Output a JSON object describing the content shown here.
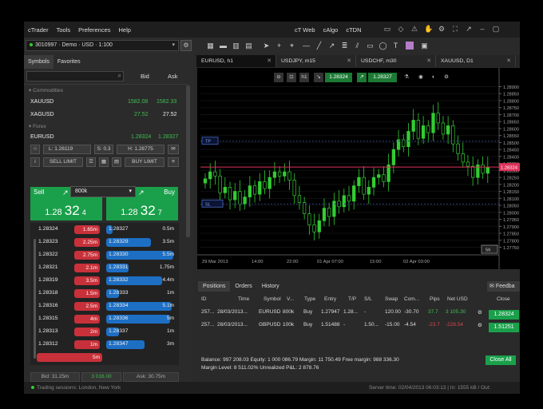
{
  "menu": {
    "items": [
      "cTrader",
      "Tools",
      "Preferences",
      "Help"
    ],
    "right_items": [
      "cT Web",
      "cAlgo",
      "cTDN"
    ]
  },
  "account": {
    "label": "3010997 · Demo · USD · 1:100"
  },
  "watchlist": {
    "tabs": [
      "Symbols",
      "Favorites"
    ],
    "bid_header": "Bid",
    "ask_header": "Ask",
    "groups": [
      {
        "name": "Commodities",
        "symbols": [
          {
            "name": "XAUUSD",
            "bid": "1582.08",
            "ask": "1582.33"
          },
          {
            "name": "XAGUSD",
            "bid": "27.52",
            "ask": "27.52"
          }
        ]
      },
      {
        "name": "Forex",
        "symbols": [
          {
            "name": "EURUSD",
            "bid": "1.28324",
            "ask": "1.28327"
          }
        ]
      }
    ],
    "expanded": {
      "low": "L: 1.28119",
      "spread": "S: 0.3",
      "high": "H: 1.28775",
      "sell_limit": "SELL LIMIT",
      "buy_limit": "BUY LIMIT"
    }
  },
  "trade": {
    "sell_label": "Sell",
    "buy_label": "Buy",
    "quantity": "800k",
    "sell_price": {
      "prefix": "1.28",
      "big": "32",
      "suffix": "4"
    },
    "buy_price": {
      "prefix": "1.28",
      "big": "32",
      "suffix": "7"
    }
  },
  "ladder": [
    {
      "bid": "1.28324",
      "bid_vol": "1.65m",
      "ask": "1.28327",
      "ask_vol": "0.5m"
    },
    {
      "bid": "1.28323",
      "bid_vol": "2.25m",
      "ask": "1.28329",
      "ask_vol": "3.5m"
    },
    {
      "bid": "1.28322",
      "bid_vol": "2.75m",
      "ask": "1.28330",
      "ask_vol": "5.5m"
    },
    {
      "bid": "1.28321",
      "bid_vol": "2.1m",
      "ask": "1.28331",
      "ask_vol": "1.75m"
    },
    {
      "bid": "1.28319",
      "bid_vol": "3.5m",
      "ask": "1.28332",
      "ask_vol": "4.4m"
    },
    {
      "bid": "1.28318",
      "bid_vol": "1.5m",
      "ask": "1.28333",
      "ask_vol": "1m"
    },
    {
      "bid": "1.28316",
      "bid_vol": "2.5m",
      "ask": "1.28334",
      "ask_vol": "5.1m"
    },
    {
      "bid": "1.28315",
      "bid_vol": "4m",
      "ask": "1.28336",
      "ask_vol": "5m"
    },
    {
      "bid": "1.28313",
      "bid_vol": "2m",
      "ask": "1.28337",
      "ask_vol": "1m"
    },
    {
      "bid": "1.28312",
      "bid_vol": "1m",
      "ask": "1.28347",
      "ask_vol": "3m"
    },
    {
      "bid": "1.28311",
      "bid_vol": "5m",
      "ask": "",
      "ask_vol": ""
    }
  ],
  "ladder_footer": {
    "bid": "Bid: 31.25m",
    "mid": "3 016.00",
    "ask": "Ask: 30.75m"
  },
  "status_bar": {
    "left": "Trading sessions: London, New York",
    "right": "Server time: 02/04/2013 06:03:13 | In: 1555 kB / Out:"
  },
  "chart_tabs": [
    {
      "label": "EURUSD, h1",
      "active": true
    },
    {
      "label": "USDJPY, m15",
      "active": false
    },
    {
      "label": "USDCHF, m30",
      "active": false
    },
    {
      "label": "XAUUSD, D1",
      "active": false
    }
  ],
  "chart_toolbar": {
    "sell_price": "1.28324",
    "buy_price": "1.28327"
  },
  "chart_data": {
    "type": "candlestick",
    "symbol": "EURUSD",
    "timeframe": "h1",
    "y_ticks": [
      "1.28900",
      "1.28850",
      "1.28800",
      "1.28750",
      "1.28700",
      "1.28650",
      "1.28600",
      "1.28550",
      "1.28500",
      "1.28450",
      "1.28400",
      "1.28350",
      "1.28300",
      "1.28250",
      "1.28200",
      "1.28150",
      "1.28100",
      "1.28050",
      "1.28000",
      "1.27950",
      "1.27900",
      "1.27850",
      "1.27800",
      "1.27750"
    ],
    "x_ticks": [
      "29 Mar 2013",
      "14:00",
      "22:00",
      "01 Apr 07:00",
      "15:00",
      "02 Apr 03:00"
    ],
    "ylim": [
      1.2773,
      1.2892
    ],
    "current_price": "1.28324",
    "price_line_color": "#e0325a",
    "candle_color": "#33cc33",
    "markers": [
      "TP",
      "SL"
    ],
    "zoom": "56",
    "closes": [
      1.2824,
      1.2829,
      1.2826,
      1.2814,
      1.2818,
      1.2809,
      1.2815,
      1.2806,
      1.2811,
      1.2819,
      1.2813,
      1.2822,
      1.2817,
      1.2825,
      1.2829,
      1.2826,
      1.2829,
      1.2823,
      1.2812,
      1.2807,
      1.2799,
      1.2791,
      1.2786,
      1.2794,
      1.2803,
      1.2797,
      1.2808,
      1.2804,
      1.2812,
      1.2808,
      1.2819,
      1.2825,
      1.2813,
      1.2818,
      1.2825,
      1.2827,
      1.2822,
      1.2834,
      1.2845,
      1.2852,
      1.2847,
      1.2858,
      1.2866,
      1.2853,
      1.2862,
      1.2857,
      1.2871,
      1.2864,
      1.2856,
      1.2862,
      1.2849,
      1.2842,
      1.2836,
      1.2833,
      1.2825,
      1.2834,
      1.2828,
      1.2832
    ]
  },
  "positions": {
    "tabs": [
      "Positions",
      "Orders",
      "History"
    ],
    "feedback": "Feedba",
    "headers": [
      "ID",
      "Time",
      "Symbol",
      "V...",
      "Type",
      "Entry",
      "T/P",
      "S/L",
      "Swap",
      "Com...",
      "Pips",
      "Net USD",
      "Close"
    ],
    "rows": [
      {
        "id": "257...",
        "time": "28/03/2013...",
        "symbol": "EURUSD",
        "volume": "800k",
        "type": "Buy",
        "entry": "1.27947",
        "tp": "1.28...",
        "sl": "-",
        "swap": "120.00",
        "com": "-30.70",
        "pips": "37.7",
        "net": "3 105.30",
        "close": "1.28324"
      },
      {
        "id": "257...",
        "time": "28/03/2013...",
        "symbol": "GBPUSD",
        "volume": "100k",
        "type": "Buy",
        "entry": "1.51488",
        "tp": "-",
        "sl": "1.50...",
        "swap": "-15.00",
        "com": "-4.54",
        "pips": "-23.7",
        "net": "-226.54",
        "close": "1.51251"
      }
    ],
    "close_all": "Close All",
    "summary1": "Balance: 997 208.03   Equity: 1 000 086.79   Margin: 11 750.49   Free margin: 988 336.30",
    "summary2": "Margin Level: 8 511.02%   Unrealized P&L: 2 878.76"
  },
  "colors": {
    "accent_green": "#1aa04a",
    "sell_red": "#c8313a",
    "buy_blue": "#1d6fc4",
    "price_green": "#3fbf4f"
  }
}
